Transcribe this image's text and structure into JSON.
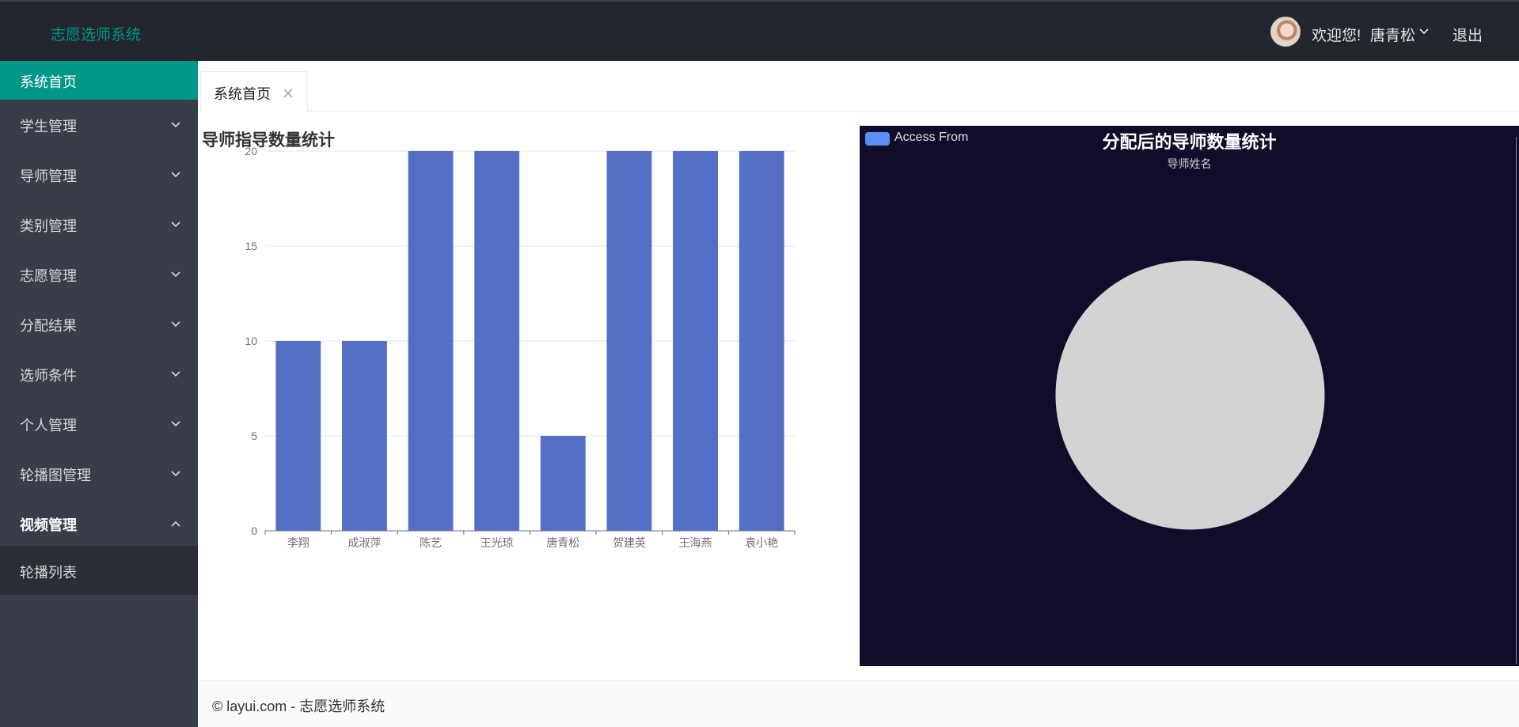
{
  "header": {
    "app_title": "志愿选师系统",
    "welcome": "欢迎您!",
    "user_name": "唐青松",
    "logout": "退出"
  },
  "sidebar": {
    "home": "系统首页",
    "items": [
      {
        "label": "学生管理",
        "expanded": false
      },
      {
        "label": "导师管理",
        "expanded": false
      },
      {
        "label": "类别管理",
        "expanded": false
      },
      {
        "label": "志愿管理",
        "expanded": false
      },
      {
        "label": "分配结果",
        "expanded": false
      },
      {
        "label": "选师条件",
        "expanded": false
      },
      {
        "label": "个人管理",
        "expanded": false
      },
      {
        "label": "轮播图管理",
        "expanded": false
      },
      {
        "label": "视频管理",
        "expanded": true
      }
    ],
    "sub_item": "轮播列表"
  },
  "tabs": [
    {
      "label": "系统首页"
    }
  ],
  "left_chart": {
    "title": "导师指导数量统计"
  },
  "right_chart": {
    "title": "分配后的导师数量统计",
    "subtitle": "导师姓名",
    "legend": "Access From",
    "background": "#110c2a",
    "legend_color": "#5b8ff9",
    "pie_color": "#d3d3d3"
  },
  "footer": {
    "text": "© layui.com - 志愿选师系统"
  },
  "colors": {
    "accent": "#009688",
    "bar": "#5470c6",
    "header_bg": "#23262e",
    "sidebar_bg": "#393d49"
  },
  "chart_data": [
    {
      "type": "bar",
      "title": "导师指导数量统计",
      "categories": [
        "李翔",
        "成淑萍",
        "陈艺",
        "王光琼",
        "唐青松",
        "贺建英",
        "王海燕",
        "袁小艳"
      ],
      "values": [
        10,
        10,
        20,
        20,
        5,
        20,
        20,
        20
      ],
      "ylim": [
        0,
        20
      ],
      "yticks": [
        0,
        5,
        10,
        15,
        20
      ],
      "grid": true
    },
    {
      "type": "pie",
      "title": "分配后的导师数量统计",
      "subtitle": "导师姓名",
      "legend": [
        "Access From"
      ],
      "legend_position": "top-left",
      "slices": []
    }
  ]
}
